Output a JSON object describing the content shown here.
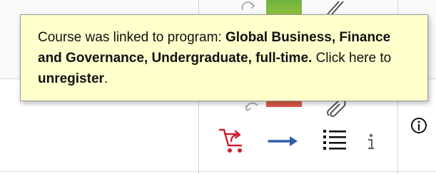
{
  "tooltip": {
    "prefix": "Course was linked to program: ",
    "program": "Global Business, Finance and Governance, Undergraduate, full-time.",
    "middle": " Click here to ",
    "action": "unregister",
    "suffix": "."
  },
  "icons": {
    "cart": "cart-remove-icon",
    "arrow": "arrow-right-icon",
    "list": "list-icon",
    "info": "info-icon",
    "info_circle": "info-circle-icon"
  },
  "colors": {
    "tooltip_bg": "#ffffcc",
    "cart": "#cc1f2f",
    "arrow": "#2f5ea8",
    "list": "#111111"
  }
}
